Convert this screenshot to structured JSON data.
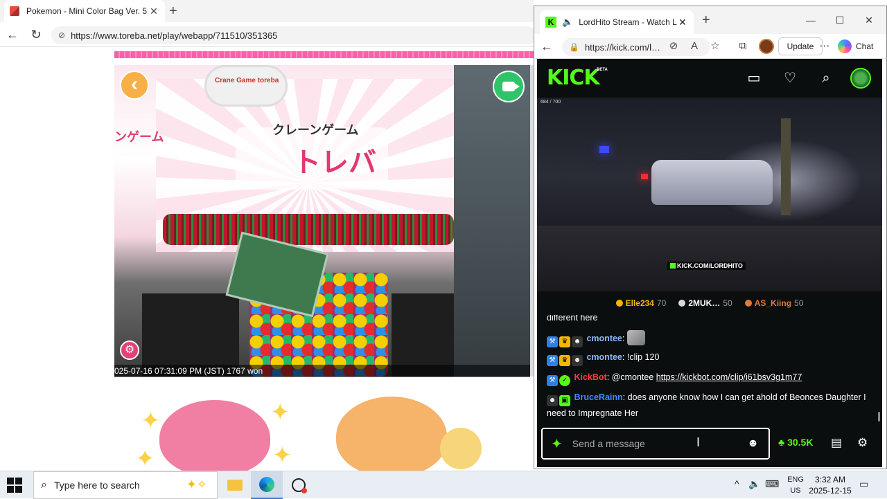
{
  "left_browser": {
    "tab_title": "Pokemon - Mini Color Bag Ver. 5…",
    "url": "https://www.toreba.net/play/webapp/711510/351365",
    "camera": {
      "sign_text_main": "トレバ",
      "sign_text_top": "クレーンゲーム",
      "sign_text_left": "ンゲーム",
      "claw_label": "Crane Game toreba",
      "timestamp": "025-07-16 07:31:09 PM (JST) 1767 won"
    }
  },
  "right_browser": {
    "tab_title": "LordHito Stream - Watch Live",
    "url": "https://kick.com/l…",
    "update_label": "Update",
    "chat_label": "Chat",
    "kick": {
      "logo": "KICK",
      "beta": "BETA",
      "viewer_counter": "684 / 700",
      "watermark": "KICK.COM/LORDHITO",
      "leaderboard": [
        {
          "name": "Elle234",
          "count": "70",
          "color": "#f4b600"
        },
        {
          "name": "2MUK…",
          "count": "50",
          "color": "#d8d8d8"
        },
        {
          "name": "AS_Kiing",
          "count": "50",
          "color": "#e07b3a"
        }
      ],
      "chat": {
        "msg0": {
          "text": "different here"
        },
        "msg1": {
          "user": "cmontee",
          "sep": ":",
          "user_color": "#8fb6ff"
        },
        "msg2": {
          "user": "cmontee",
          "sep": ":",
          "text": " !clip 120",
          "user_color": "#8fb6ff"
        },
        "msg3": {
          "user": "KickBot",
          "sep": ":",
          "text": " @cmontee ",
          "link": "https://kickbot.com/clip/i61bsv3g1m77",
          "user_color": "#ff3b4a"
        },
        "msg4": {
          "user": "BruceRainn",
          "sep": ":",
          "text": " does anyone know how I can get ahold of Beonces Daughter I need to Impregnate Her",
          "user_color": "#3b8dff"
        }
      },
      "input_placeholder": "Send a message",
      "points": "30.5K"
    }
  },
  "taskbar": {
    "search_placeholder": "Type here to search",
    "lang_line1": "ENG",
    "lang_line2": "US",
    "time": "3:32 AM",
    "date": "2025-12-15"
  },
  "colors": {
    "kick_green": "#53fc18",
    "kick_bg": "#0b0e0f",
    "toreba_pink": "#ff5fa8"
  }
}
